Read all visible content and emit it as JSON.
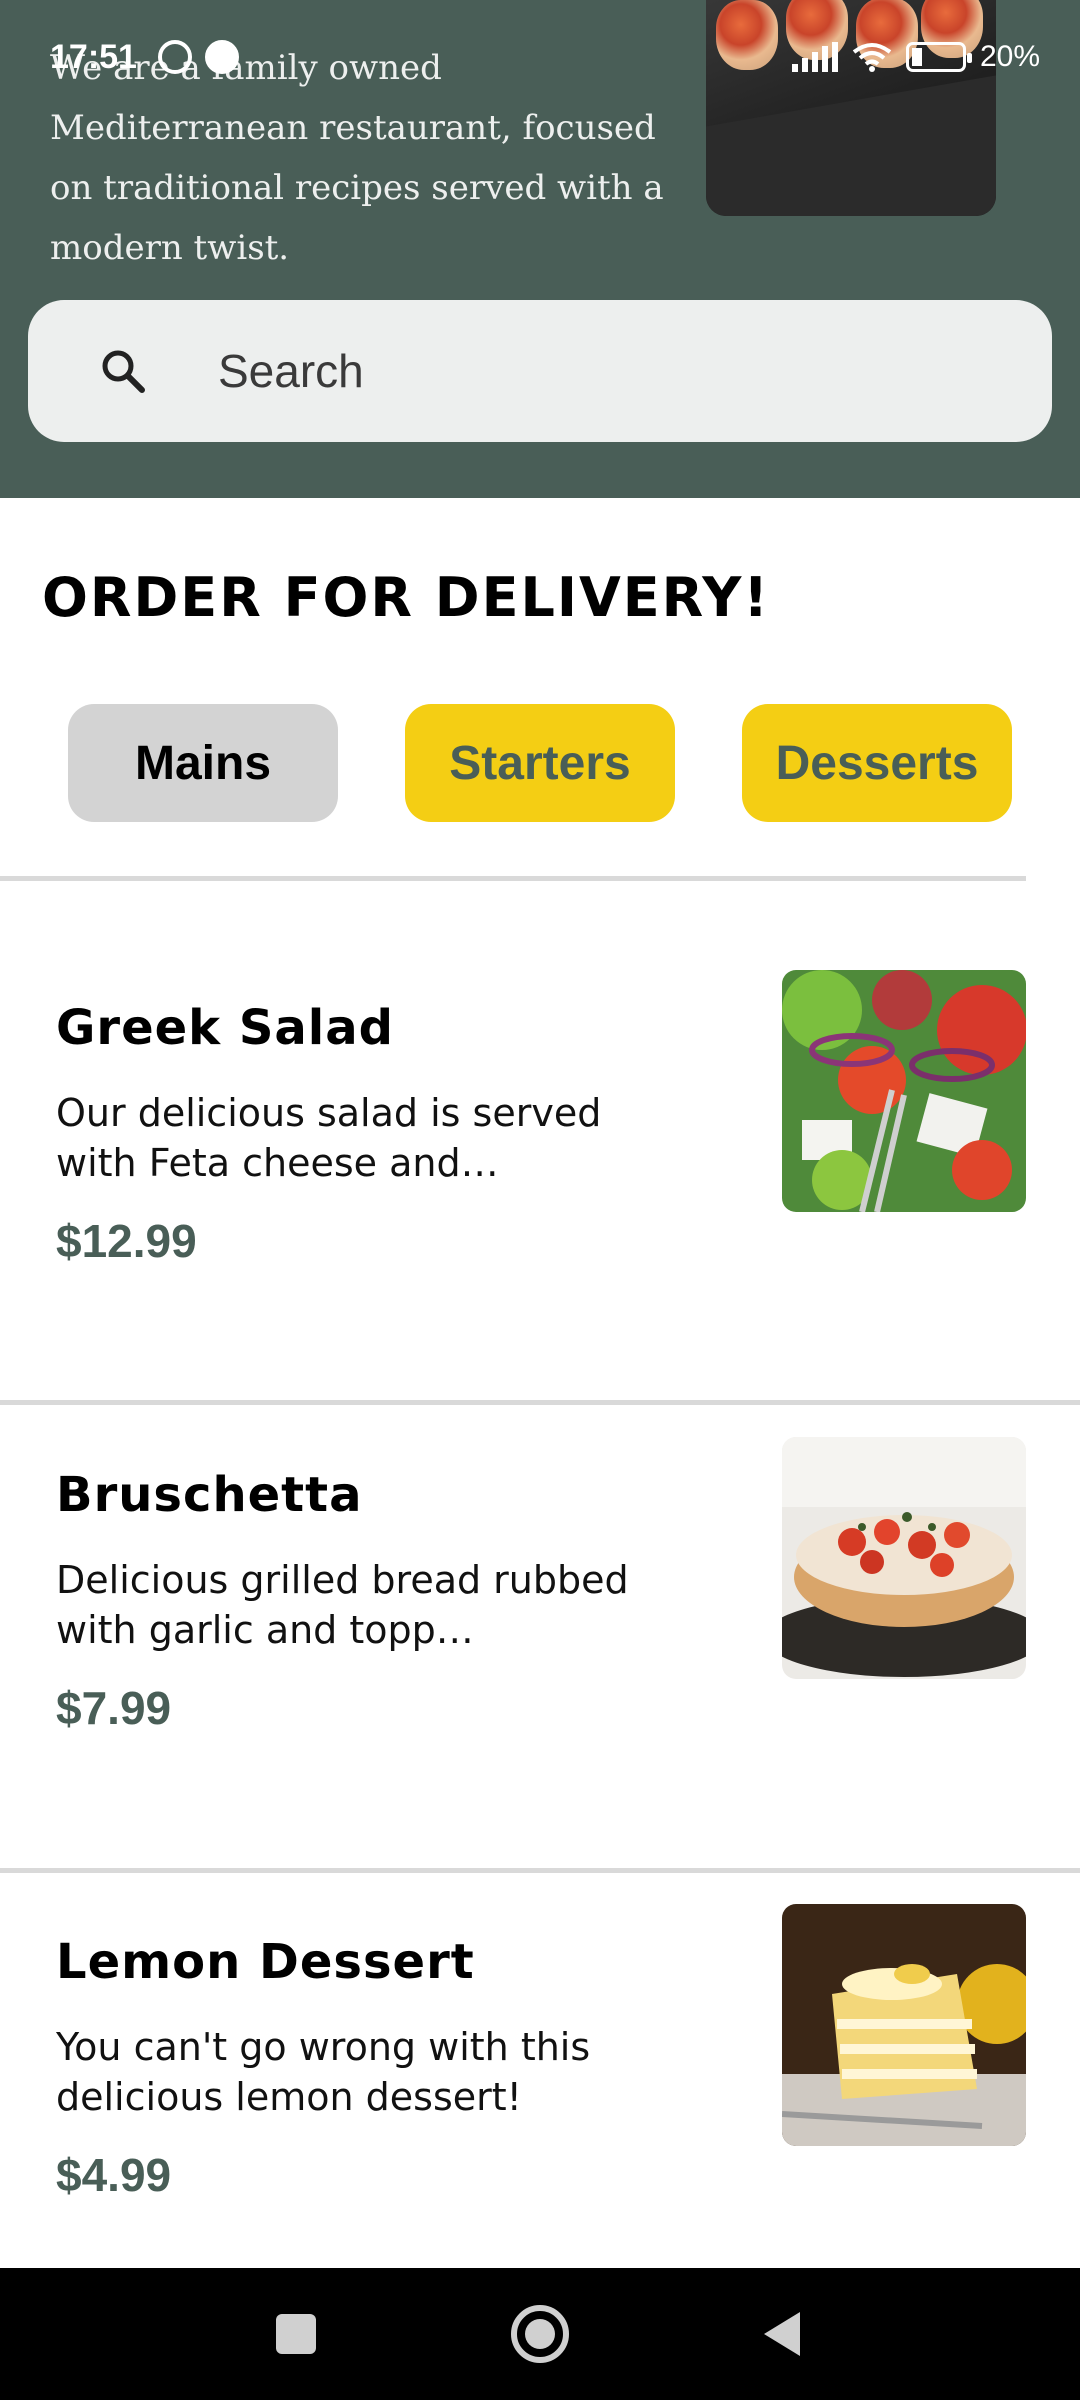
{
  "status_bar": {
    "time": "17:51",
    "battery_percent": "20%"
  },
  "hero": {
    "description": "We are a family owned Mediterranean restaurant, focused on traditional recipes served with a modern twist."
  },
  "search": {
    "placeholder": "Search"
  },
  "section": {
    "title": "ORDER FOR DELIVERY!"
  },
  "categories": [
    {
      "label": "Mains",
      "selected": true
    },
    {
      "label": "Starters",
      "selected": false
    },
    {
      "label": "Desserts",
      "selected": false
    }
  ],
  "menu_items": [
    {
      "name": "Greek Salad",
      "description": "Our delicious salad is served with Feta cheese and…",
      "price": "$12.99"
    },
    {
      "name": "Bruschetta",
      "description": "Delicious grilled bread rubbed with garlic and topp…",
      "price": "$7.99"
    },
    {
      "name": "Lemon Dessert",
      "description": "You can't go wrong with this delicious lemon dessert!",
      "price": "$4.99"
    }
  ],
  "colors": {
    "primary_green": "#495e57",
    "accent_yellow": "#f4ce14",
    "chip_selected": "#d3d3d3"
  }
}
